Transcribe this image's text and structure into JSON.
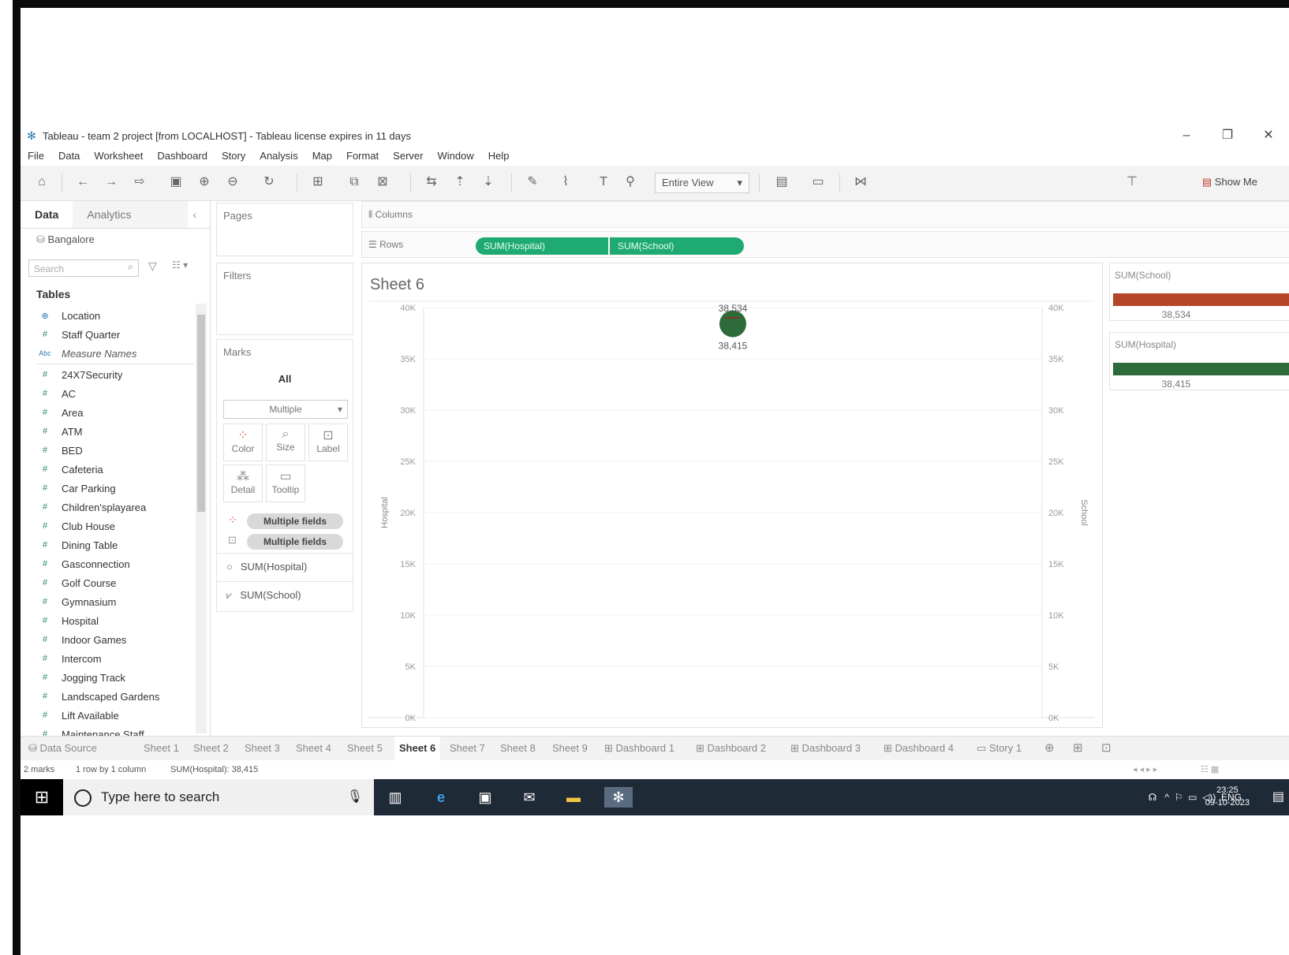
{
  "window": {
    "title": "Tableau - team 2 project [from LOCALHOST] - Tableau license expires in 11 days",
    "controls": [
      "–",
      "❐",
      "✕"
    ]
  },
  "menu": [
    "File",
    "Data",
    "Worksheet",
    "Dashboard",
    "Story",
    "Analysis",
    "Map",
    "Format",
    "Server",
    "Window",
    "Help"
  ],
  "toolbar": {
    "fit_dropdown": "Entire View",
    "show_me": "Show Me"
  },
  "data_pane": {
    "tabs": [
      "Data",
      "Analytics"
    ],
    "datasource": "Bangalore",
    "search_placeholder": "Search",
    "tables_label": "Tables",
    "fields": [
      {
        "name": "Location",
        "type": "geo"
      },
      {
        "name": "Staff Quarter",
        "type": "measure"
      },
      {
        "name": "Measure Names",
        "type": "abc"
      },
      {
        "name": "24X7Security",
        "type": "measure"
      },
      {
        "name": "AC",
        "type": "measure"
      },
      {
        "name": "Area",
        "type": "measure"
      },
      {
        "name": "ATM",
        "type": "measure"
      },
      {
        "name": "BED",
        "type": "measure"
      },
      {
        "name": "Cafeteria",
        "type": "measure"
      },
      {
        "name": "Car Parking",
        "type": "measure"
      },
      {
        "name": "Children'splayarea",
        "type": "measure"
      },
      {
        "name": "Club House",
        "type": "measure"
      },
      {
        "name": "Dining Table",
        "type": "measure"
      },
      {
        "name": "Gasconnection",
        "type": "measure"
      },
      {
        "name": "Golf Course",
        "type": "measure"
      },
      {
        "name": "Gymnasium",
        "type": "measure"
      },
      {
        "name": "Hospital",
        "type": "measure"
      },
      {
        "name": "Indoor Games",
        "type": "measure"
      },
      {
        "name": "Intercom",
        "type": "measure"
      },
      {
        "name": "Jogging Track",
        "type": "measure"
      },
      {
        "name": "Landscaped Gardens",
        "type": "measure"
      },
      {
        "name": "Lift Available",
        "type": "measure"
      },
      {
        "name": "Maintenance Staff",
        "type": "measure"
      }
    ]
  },
  "cards": {
    "pages": "Pages",
    "filters": "Filters",
    "marks": "Marks",
    "marks_all": "All",
    "mark_type": "Multiple",
    "buttons": [
      "Color",
      "Size",
      "Label",
      "Detail",
      "Tooltip"
    ],
    "pills": [
      "Multiple fields",
      "Multiple fields"
    ],
    "sum_items": [
      "SUM(Hospital)",
      "SUM(School)"
    ]
  },
  "shelves": {
    "columns_label": "Columns",
    "rows_label": "Rows",
    "rows_pills": [
      "SUM(Hospital)",
      "SUM(School)"
    ]
  },
  "view": {
    "sheet_title": "Sheet 6"
  },
  "chart_data": {
    "type": "scatter",
    "title": "Sheet 6",
    "ylabel": "Hospital",
    "y2label": "School",
    "ylim": [
      0,
      40000
    ],
    "y2lim": [
      0,
      40000
    ],
    "yticks": [
      "0K",
      "5K",
      "10K",
      "15K",
      "20K",
      "25K",
      "30K",
      "35K",
      "40K"
    ],
    "series": [
      {
        "name": "SUM(Hospital)",
        "values": [
          38415
        ],
        "label": "38,415",
        "color": "#2e6b3a"
      },
      {
        "name": "SUM(School)",
        "values": [
          38534
        ],
        "label": "38,534"
      }
    ],
    "grid": true
  },
  "legends": [
    {
      "title": "SUM(School)",
      "value": "38,534",
      "color": "#b5462a"
    },
    {
      "title": "SUM(Hospital)",
      "value": "38,415",
      "color": "#2e6b3a"
    }
  ],
  "sheet_tabs": [
    "Data Source",
    "Sheet 1",
    "Sheet 2",
    "Sheet 3",
    "Sheet 4",
    "Sheet 5",
    "Sheet 6",
    "Sheet 7",
    "Sheet 8",
    "Sheet 9",
    "Dashboard 1",
    "Dashboard 2",
    "Dashboard 3",
    "Dashboard 4",
    "Story 1"
  ],
  "active_tab": "Sheet 6",
  "status": {
    "marks": "2 marks",
    "rows": "1 row by 1 column",
    "sum": "SUM(Hospital): 38,415"
  },
  "taskbar": {
    "search_placeholder": "Type here to search",
    "language": "ENG",
    "time": "23:25",
    "date": "09-10-2023"
  },
  "colors": {
    "pill_green": "#1fa973",
    "hospital_green": "#2e6b3a",
    "school_orange": "#b5462a"
  }
}
